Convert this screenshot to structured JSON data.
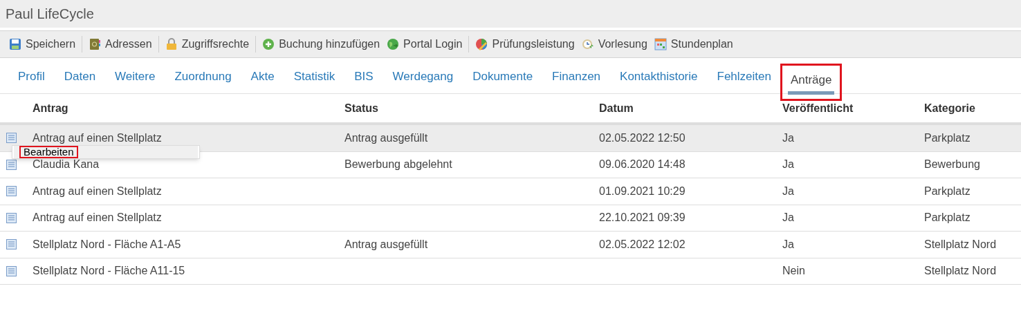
{
  "window": {
    "title": "Paul LifeCycle"
  },
  "toolbar": [
    {
      "label": "Speichern",
      "kind": "save",
      "separator_after": true
    },
    {
      "label": "Adressen",
      "kind": "book",
      "separator_after": true
    },
    {
      "label": "Zugriffsrechte",
      "kind": "lock",
      "separator_after": true
    },
    {
      "label": "Buchung hinzufügen",
      "kind": "add",
      "separator_after": false
    },
    {
      "label": "Portal Login",
      "kind": "globe",
      "separator_after": true
    },
    {
      "label": "Prüfungsleistung",
      "kind": "chart",
      "separator_after": false
    },
    {
      "label": "Vorlesung",
      "kind": "clock",
      "separator_after": false
    },
    {
      "label": "Stundenplan",
      "kind": "calendar",
      "separator_after": false
    }
  ],
  "tabs": [
    {
      "label": "Profil",
      "selected": false
    },
    {
      "label": "Daten",
      "selected": false
    },
    {
      "label": "Weitere",
      "selected": false
    },
    {
      "label": "Zuordnung",
      "selected": false
    },
    {
      "label": "Akte",
      "selected": false
    },
    {
      "label": "Statistik",
      "selected": false
    },
    {
      "label": "BIS",
      "selected": false
    },
    {
      "label": "Werdegang",
      "selected": false
    },
    {
      "label": "Dokumente",
      "selected": false
    },
    {
      "label": "Finanzen",
      "selected": false
    },
    {
      "label": "Kontakthistorie",
      "selected": false
    },
    {
      "label": "Fehlzeiten",
      "selected": false
    },
    {
      "label": "Anträge",
      "selected": true
    }
  ],
  "table": {
    "columns": [
      "Antrag",
      "Status",
      "Datum",
      "Veröffentlicht",
      "Kategorie"
    ],
    "rows": [
      {
        "cells": [
          "Antrag auf einen Stellplatz",
          "Antrag ausgefüllt",
          "02.05.2022 12:50",
          "Ja",
          "Parkplatz"
        ],
        "selected": true
      },
      {
        "cells": [
          "Claudia Kana",
          "Bewerbung abgelehnt",
          "09.06.2020 14:48",
          "Ja",
          "Bewerbung"
        ],
        "selected": false
      },
      {
        "cells": [
          "Antrag auf einen Stellplatz",
          "",
          "01.09.2021 10:29",
          "Ja",
          "Parkplatz"
        ],
        "selected": false
      },
      {
        "cells": [
          "Antrag auf einen Stellplatz",
          "",
          "22.10.2021 09:39",
          "Ja",
          "Parkplatz"
        ],
        "selected": false
      },
      {
        "cells": [
          "Stellplatz Nord - Fläche A1-A5",
          "Antrag ausgefüllt",
          "02.05.2022 12:02",
          "Ja",
          "Stellplatz Nord"
        ],
        "selected": false
      },
      {
        "cells": [
          "Stellplatz Nord - Fläche A11-15",
          "",
          "",
          "Nein",
          "Stellplatz Nord"
        ],
        "selected": false
      }
    ]
  },
  "context_menu": {
    "items": [
      {
        "label": "Bearbeiten",
        "highlighted": true
      }
    ]
  }
}
